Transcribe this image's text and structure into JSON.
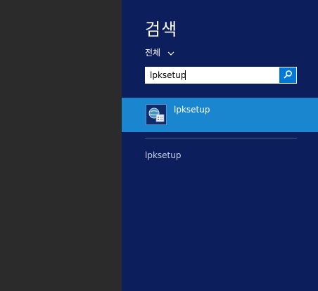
{
  "search_pane": {
    "title": "검색",
    "scope_label": "전체",
    "search_query": "lpksetup",
    "results": [
      {
        "label": "lpksetup",
        "icon": "settings-app-icon"
      }
    ],
    "suggestions": [
      "lpksetup"
    ]
  },
  "colors": {
    "desktop": "#2b2b2b",
    "pane_bg": "#0c1f5c",
    "selected_row": "#1a86d0",
    "search_button": "#0078d7"
  }
}
